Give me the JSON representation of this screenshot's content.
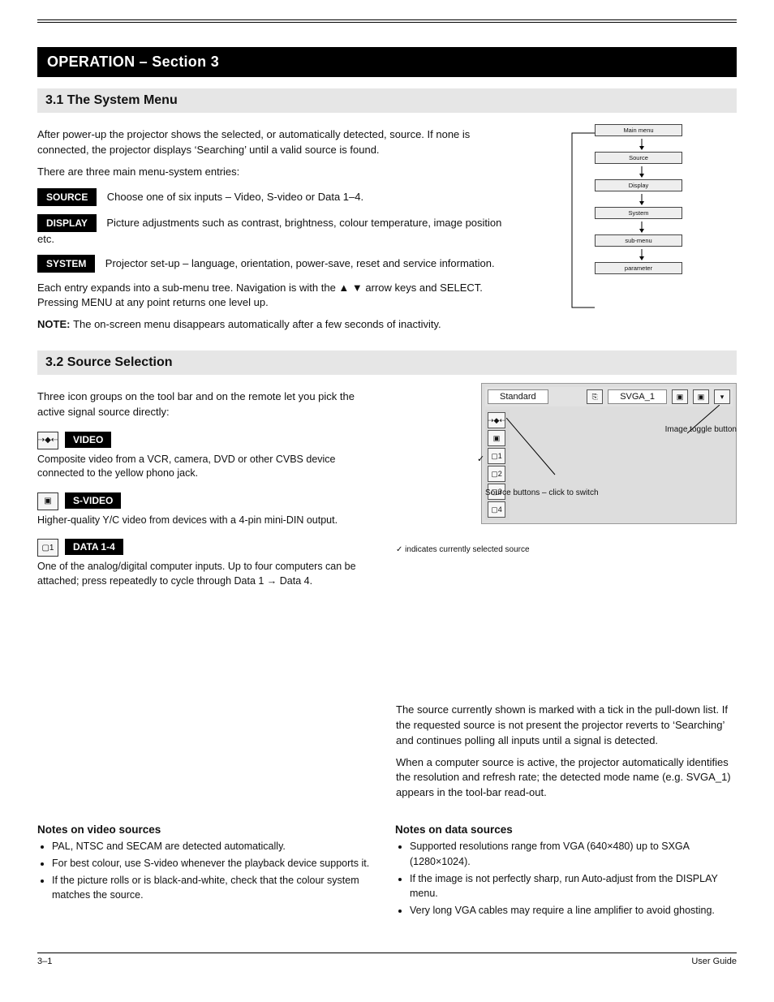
{
  "header_rule": true,
  "section_title": "OPERATION – Section 3",
  "sub1": {
    "title": "3.1  The System Menu",
    "p1": "After power-up the projector shows the selected, or automatically detected, source. If none is connected, the projector displays ‘Searching’ until a valid source is found.",
    "p2": "There are three main menu-system entries:",
    "menu_items": [
      {
        "tag": "SOURCE",
        "desc": "Choose one of six inputs – Video, S-video or Data 1–4."
      },
      {
        "tag": "DISPLAY",
        "desc": "Picture adjustments such as contrast, brightness, colour temperature, image position etc."
      },
      {
        "tag": "SYSTEM",
        "desc": "Projector set-up – language, orientation, power-save, reset and service information."
      }
    ],
    "p3": "Each entry expands into a sub-menu tree. Navigation is with the ▲ ▼ arrow keys and SELECT. Pressing MENU at any point returns one level up.",
    "note_label": "NOTE: ",
    "note_text": "The on-screen menu disappears automatically after a few seconds of inactivity.",
    "flow_nodes": [
      "Main menu",
      "Source",
      "Display",
      "System",
      "sub-menu",
      "parameter"
    ]
  },
  "sub2": {
    "title": "3.2  Source Selection",
    "left_intro": "Three icon groups on the tool bar and on the remote let you pick the active signal source directly:",
    "rows": [
      {
        "icon_label": "⇢◆⇠",
        "chip": "VIDEO",
        "desc": "Composite video from a VCR, camera, DVD or other CVBS device connected to the yellow phono jack."
      },
      {
        "icon_label": "▣",
        "chip": "S-VIDEO",
        "desc": "Higher-quality Y/C video from devices with a 4-pin mini-DIN output."
      },
      {
        "icon_label": "▢1",
        "chip": "DATA 1-4",
        "desc": "One of the analog/digital computer inputs. Up to four computers can be attached; press repeatedly to cycle through Data 1 → Data 4."
      }
    ],
    "toolbar": {
      "mode_label": "Standard",
      "res_label": "SVGA_1",
      "side_icons": [
        "⇢◆⇠",
        "▣",
        "▢1",
        "▢2",
        "▢3",
        "▢4"
      ],
      "top_btns": [
        "⎘",
        "▣",
        "▣",
        "▾"
      ]
    },
    "callout_left": "✓ indicates currently selected source",
    "callout_right_top": "Image toggle button",
    "callout_right_bot": "Source buttons – click to switch",
    "right_p1": "The source currently shown is marked with a tick in the pull-down list. If the requested source is not present the projector reverts to ‘Searching’ and continues polling all inputs until a signal is detected.",
    "right_p2": "When a computer source is active, the projector automatically identifies the resolution and refresh rate; the detected mode name (e.g. SVGA_1) appears in the tool-bar read-out.",
    "headA": "Notes on video sources",
    "listA": [
      "PAL, NTSC and SECAM are detected automatically.",
      "For best colour, use S-video whenever the playback device supports it.",
      "If the picture rolls or is black-and-white, check that the colour system matches the source."
    ],
    "headB": "Notes on data sources",
    "listB": [
      "Supported resolutions range from VGA (640×480) up to SXGA (1280×1024).",
      "If the image is not perfectly sharp, run Auto-adjust from the DISPLAY menu.",
      "Very long VGA cables may require a line amplifier to avoid ghosting."
    ]
  },
  "footer": {
    "left": "3–1",
    "right": "User Guide"
  }
}
